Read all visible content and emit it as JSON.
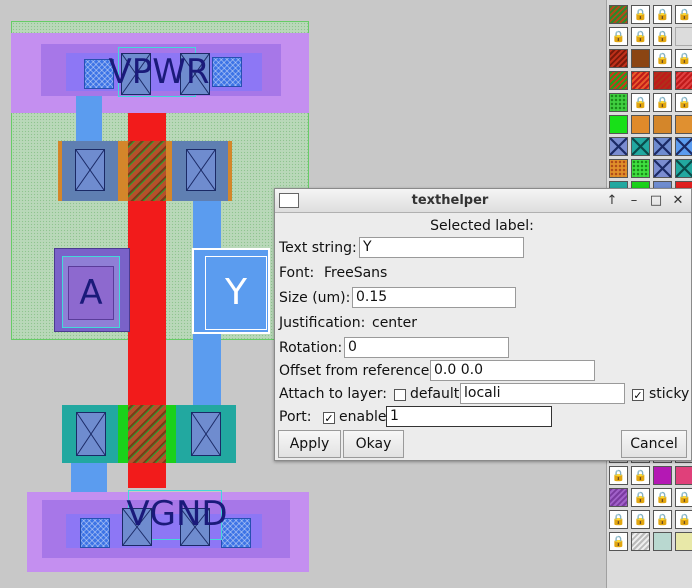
{
  "layout_view": {
    "labels": {
      "vpwr": "VPWR",
      "a": "A",
      "y": "Y",
      "vgnd": "VGND"
    }
  },
  "dialog": {
    "title": "texthelper",
    "titlebar_buttons": [
      "↑",
      "–",
      "□",
      "✕"
    ],
    "header": "Selected label:",
    "text_string": {
      "label": "Text string:",
      "value": "Y"
    },
    "font": {
      "label": "Font:",
      "value": "FreeSans"
    },
    "size": {
      "label": "Size (um):",
      "value": "0.15"
    },
    "justification": {
      "label": "Justification:",
      "value": "center"
    },
    "rotation": {
      "label": "Rotation:",
      "value": "0"
    },
    "offset": {
      "label": "Offset from reference:",
      "value": "0.0 0.0"
    },
    "attach": {
      "label": "Attach to layer:",
      "default_label": "default",
      "default_checked": false,
      "layer_value": "locali",
      "sticky_label": "sticky",
      "sticky_checked": true
    },
    "port": {
      "label": "Port:",
      "enable_label": "enable",
      "enable_checked": true,
      "value": "1"
    },
    "buttons": {
      "apply": "Apply",
      "okay": "Okay",
      "cancel": "Cancel"
    }
  },
  "palette": {
    "lock_glyph": "🔒"
  }
}
